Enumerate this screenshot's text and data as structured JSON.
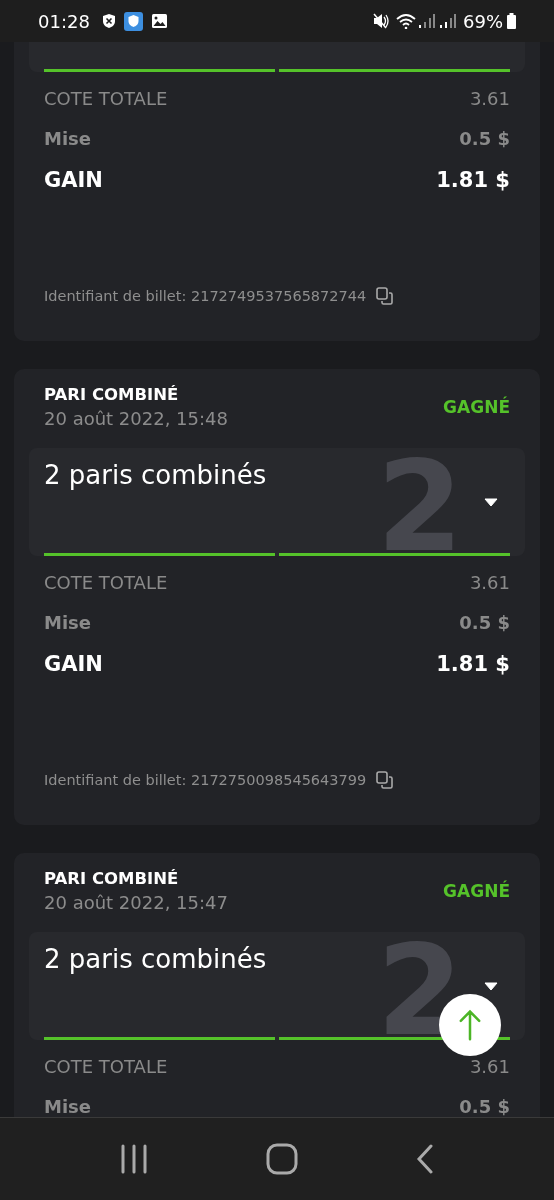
{
  "status_bar": {
    "time": "01:28",
    "battery": "69%"
  },
  "tickets": [
    {
      "legs": [
        {
          "won": true
        },
        {
          "won": true
        }
      ],
      "rows": [
        {
          "kind": "odds",
          "label": "COTE TOTALE",
          "value": "3.61"
        },
        {
          "kind": "stake",
          "label": "Mise",
          "value": "0.5 $"
        },
        {
          "kind": "payout",
          "label": "GAIN",
          "value": "1.81 $"
        }
      ],
      "ticket_id": "Identifiant de billet: 2172749537565872744"
    },
    {
      "title": "PARI COMBINÉ",
      "date": "20 août 2022, 15:48",
      "status": {
        "label": "GAGNÉ",
        "kind": "won"
      },
      "legs_label": "2 paris combinés",
      "count_watermark": "2",
      "legs": [
        {
          "won": true
        },
        {
          "won": true
        }
      ],
      "rows": [
        {
          "kind": "odds",
          "label": "COTE TOTALE",
          "value": "3.61"
        },
        {
          "kind": "stake",
          "label": "Mise",
          "value": "0.5 $"
        },
        {
          "kind": "payout",
          "label": "GAIN",
          "value": "1.81 $"
        }
      ],
      "ticket_id": "Identifiant de billet: 2172750098545643799"
    },
    {
      "title": "PARI COMBINÉ",
      "date": "20 août 2022, 15:47",
      "status": {
        "label": "GAGNÉ",
        "kind": "won"
      },
      "legs_label": "2 paris combinés",
      "count_watermark": "2",
      "legs": [
        {
          "won": true
        },
        {
          "won": true
        }
      ],
      "rows": [
        {
          "kind": "odds",
          "label": "COTE TOTALE",
          "value": "3.61"
        },
        {
          "kind": "stake",
          "label": "Mise",
          "value": "0.5 $"
        }
      ]
    }
  ]
}
